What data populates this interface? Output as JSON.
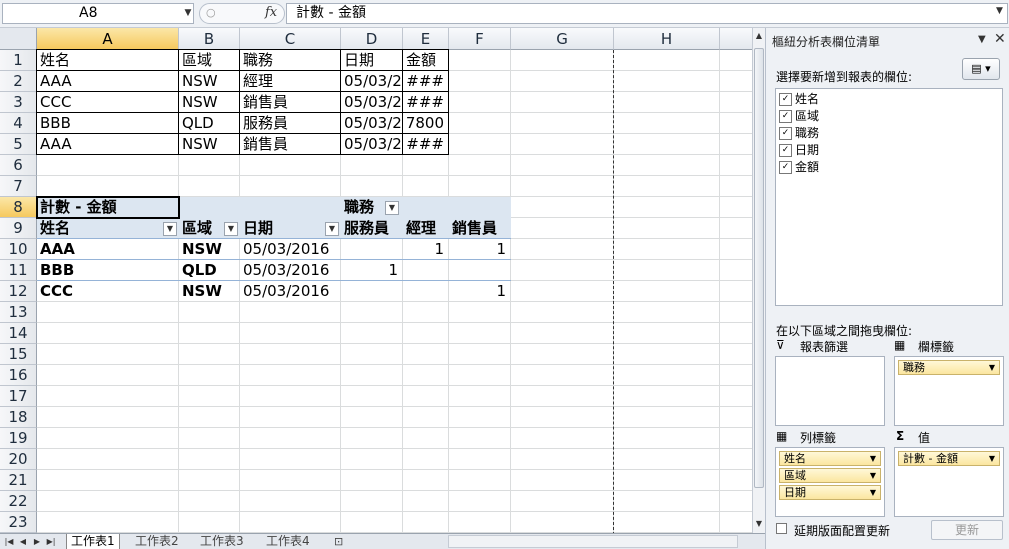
{
  "formula_bar": {
    "name_box": "A8",
    "fx": "fx",
    "formula": "計數 - 金額"
  },
  "columns": [
    "A",
    "B",
    "C",
    "D",
    "E",
    "F",
    "G",
    "H"
  ],
  "rows": [
    "1",
    "2",
    "3",
    "4",
    "5",
    "6",
    "7",
    "8",
    "9",
    "10",
    "11",
    "12",
    "13",
    "14",
    "15",
    "16",
    "17",
    "18",
    "19",
    "20",
    "21",
    "22",
    "23"
  ],
  "source_table": {
    "headers": [
      "姓名",
      "區域",
      "職務",
      "日期",
      "金額"
    ],
    "rows": [
      [
        "AAA",
        "NSW",
        "經理",
        "05/03/2",
        "###"
      ],
      [
        "CCC",
        "NSW",
        "銷售員",
        "05/03/2",
        "###"
      ],
      [
        "BBB",
        "QLD",
        "服務員",
        "05/03/2",
        "7800"
      ],
      [
        "AAA",
        "NSW",
        "銷售員",
        "05/03/2",
        "###"
      ]
    ]
  },
  "pivot": {
    "value_label": "計數 - 金額",
    "column_field": "職務",
    "row_headers": [
      "姓名",
      "區域",
      "日期"
    ],
    "column_items": [
      "服務員",
      "經理",
      "銷售員"
    ],
    "rows": [
      {
        "name": "AAA",
        "region": "NSW",
        "date": "05/03/2016",
        "v1": "",
        "v2": "1",
        "v3": "1"
      },
      {
        "name": "BBB",
        "region": "QLD",
        "date": "05/03/2016",
        "v1": "1",
        "v2": "",
        "v3": ""
      },
      {
        "name": "CCC",
        "region": "NSW",
        "date": "05/03/2016",
        "v1": "",
        "v2": "",
        "v3": "1"
      }
    ]
  },
  "sheet_tabs": [
    "工作表1",
    "工作表2",
    "工作表3",
    "工作表4"
  ],
  "pane": {
    "title": "樞紐分析表欄位清單",
    "choose_label": "選擇要新增到報表的欄位:",
    "fields": [
      "姓名",
      "區域",
      "職務",
      "日期",
      "金額"
    ],
    "drag_label": "在以下區域之間拖曳欄位:",
    "filter_label": "報表篩選",
    "column_label": "欄標籤",
    "row_label": "列標籤",
    "values_label": "值",
    "column_fields": [
      "職務"
    ],
    "row_fields": [
      "姓名",
      "區域",
      "日期"
    ],
    "value_fields": [
      "計數 - 金額"
    ],
    "defer_label": "延期版面配置更新",
    "update_label": "更新"
  },
  "colors": {
    "selection_header": "#f6c95e",
    "pivot_band": "#dce6f1",
    "pane_bg": "#eef1f5"
  }
}
